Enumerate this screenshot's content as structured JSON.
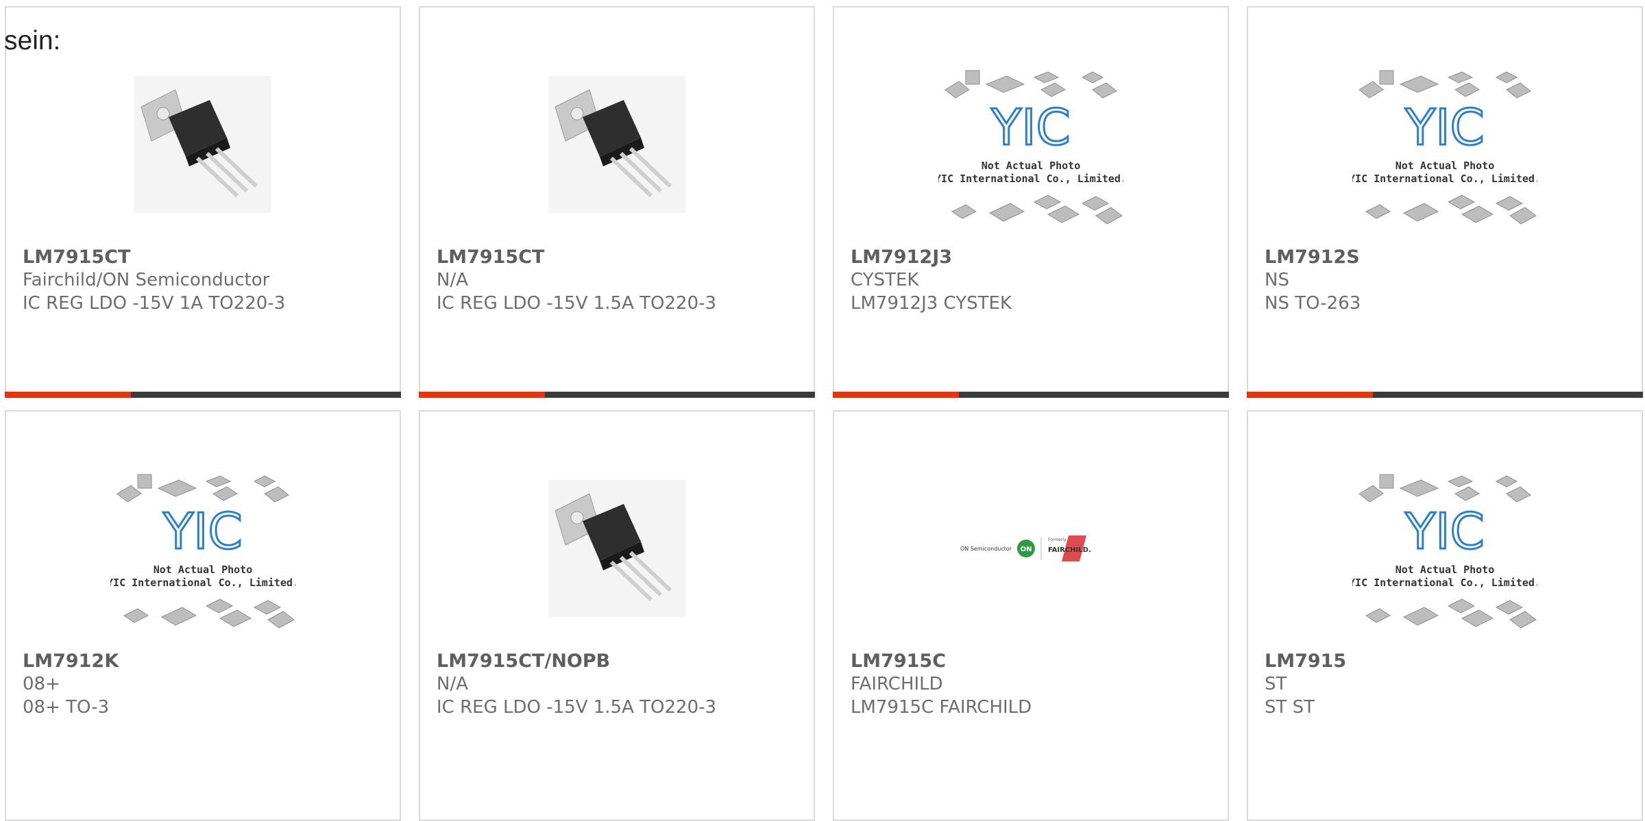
{
  "lead_text": "sein:",
  "colors": {
    "accent": "#e33512",
    "bar": "#3b3b3b",
    "border": "#d9d9d9",
    "text": "#5e5e5e"
  },
  "products": [
    {
      "part": "LM7915CT",
      "manufacturer": "Fairchild/ON Semiconductor",
      "description": "IC REG LDO -15V 1A TO220-3",
      "image": "to220-regulator-photo"
    },
    {
      "part": "LM7915CT",
      "manufacturer": "N/A",
      "description": "IC REG LDO -15V 1.5A TO220-3",
      "image": "to220-regulator-photo"
    },
    {
      "part": "LM7912J3",
      "manufacturer": "CYSTEK",
      "description": "LM7912J3 CYSTEK",
      "image": "yic-placeholder"
    },
    {
      "part": "LM7912S",
      "manufacturer": "NS",
      "description": "NS TO-263",
      "image": "yic-placeholder"
    },
    {
      "part": "LM7912K",
      "manufacturer": "08+",
      "description": "08+ TO-3",
      "image": "yic-placeholder"
    },
    {
      "part": "LM7915CT/NOPB",
      "manufacturer": "N/A",
      "description": "IC REG LDO -15V 1.5A TO220-3",
      "image": "to220-regulator-photo"
    },
    {
      "part": "LM7915C",
      "manufacturer": "FAIRCHILD",
      "description": "LM7915C FAIRCHILD",
      "image": "onsemi-fairchild-logo"
    },
    {
      "part": "LM7915",
      "manufacturer": "ST",
      "description": "ST ST",
      "image": "yic-placeholder"
    }
  ],
  "placeholder": {
    "logo": "YIC",
    "line1": "Not Actual Photo",
    "line2": "YIC International Co., Limited."
  },
  "brand_logo": {
    "on_semi": "ON Semiconductor",
    "on_mark": "ON",
    "formerly": "Formerly",
    "fairchild": "FAIRCHILD."
  }
}
